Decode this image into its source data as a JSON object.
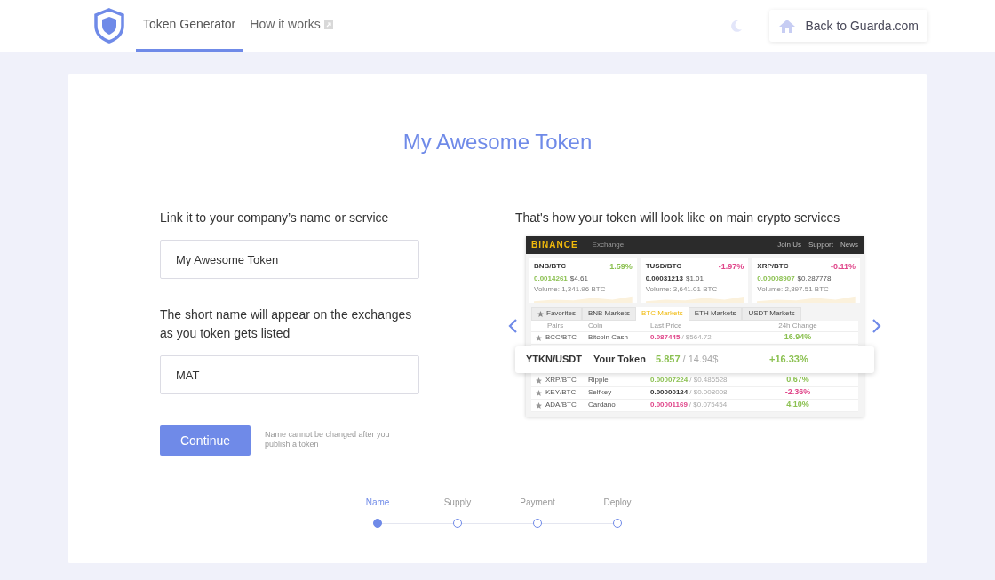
{
  "header": {
    "nav": [
      {
        "label": "Token Generator",
        "selected": true,
        "external": false
      },
      {
        "label": "How it works",
        "selected": false,
        "external": true
      }
    ],
    "back_button": "Back to Guarda.com"
  },
  "title": "My Awesome Token",
  "form": {
    "fields": [
      {
        "label": "Link it to your company’s name or service",
        "value": "My Awesome Token"
      },
      {
        "label": "The short name will appear on the exchanges as you token gets listed",
        "value": "MAT"
      }
    ],
    "continue_button": "Continue",
    "note": "Name cannot be changed after you publish a token"
  },
  "preview": {
    "caption": "That's how your token will look like on main crypto services",
    "exchange": {
      "brand": "BINANCE",
      "section": "Exchange",
      "links": [
        "Join Us",
        "Support",
        "News"
      ],
      "tickers": [
        {
          "pair": "BNB/BTC",
          "change": {
            "text": "1.59%",
            "color": "#8cc152"
          },
          "price": {
            "text": "0.0014261",
            "color": "#8cc152"
          },
          "usd": "$4.61",
          "volume": "Volume: 1,341.96 BTC"
        },
        {
          "pair": "TUSD/BTC",
          "change": {
            "text": "-1.97%",
            "color": "#e0468a"
          },
          "price": {
            "text": "0.00031213",
            "color": "#333333"
          },
          "usd": "$1.01",
          "volume": "Volume: 3,641.01 BTC"
        },
        {
          "pair": "XRP/BTC",
          "change": {
            "text": "-0.11%",
            "color": "#e0468a"
          },
          "price": {
            "text": "0.00008907",
            "color": "#8cc152"
          },
          "usd": "$0.287778",
          "volume": "Volume: 2,897.51 BTC"
        }
      ],
      "tabs": [
        {
          "label": "Favorites",
          "selected": false,
          "star": true
        },
        {
          "label": "BNB Markets",
          "selected": false,
          "star": false
        },
        {
          "label": "BTC Markets",
          "selected": true,
          "star": false
        },
        {
          "label": "ETH Markets",
          "selected": false,
          "star": false
        },
        {
          "label": "USDT Markets",
          "selected": false,
          "star": false
        }
      ],
      "columns": [
        "Pairs",
        "Coin",
        "Last Price",
        "24h Change"
      ],
      "rows": [
        {
          "kind": "market",
          "pair": "BCC/BTC",
          "coin": "Bitcoin Cash",
          "price": {
            "text": "0.087445",
            "color": "#e0468a"
          },
          "usd": "/ $564.72",
          "change": {
            "text": "16.94%",
            "color": "#8cc152"
          }
        },
        {
          "kind": "highlight",
          "pair": "YTKN/USDT",
          "coin": "Your Token",
          "price": {
            "text": "5.857",
            "color": "#8cc152"
          },
          "usd": "/ 14.94$",
          "change": {
            "text": "+16.33%",
            "color": "#8cc152"
          }
        },
        {
          "kind": "market",
          "pair": "XRP/BTC",
          "coin": "Ripple",
          "price": {
            "text": "0.00007224",
            "color": "#8cc152"
          },
          "usd": "/ $0.486528",
          "change": {
            "text": "0.67%",
            "color": "#8cc152"
          }
        },
        {
          "kind": "market",
          "pair": "KEY/BTC",
          "coin": "Selfkey",
          "price": {
            "text": "0.00000124",
            "color": "#333333"
          },
          "usd": "/ $0.008008",
          "change": {
            "text": "-2.36%",
            "color": "#e0468a"
          }
        },
        {
          "kind": "market",
          "pair": "ADA/BTC",
          "coin": "Cardano",
          "price": {
            "text": "0.00001169",
            "color": "#e0468a"
          },
          "usd": "/ $0.075454",
          "change": {
            "text": "4.10%",
            "color": "#8cc152"
          }
        }
      ]
    }
  },
  "stepper": [
    {
      "label": "Name",
      "selected": true
    },
    {
      "label": "Supply",
      "selected": false
    },
    {
      "label": "Payment",
      "selected": false
    },
    {
      "label": "Deploy",
      "selected": false
    }
  ]
}
